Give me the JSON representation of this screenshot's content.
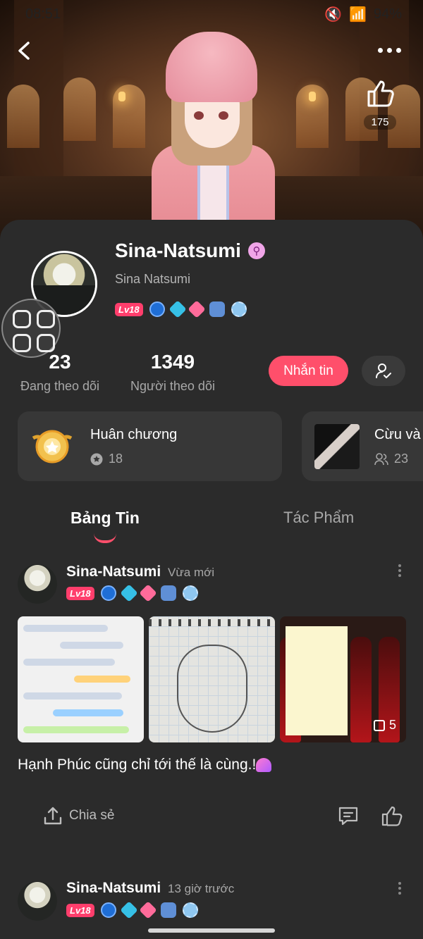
{
  "status_bar": {
    "time": "08:51",
    "battery": "94%"
  },
  "hero": {
    "like_count": "175"
  },
  "profile": {
    "name": "Sina-Natsumi",
    "gender_symbol": "⚲",
    "handle": "Sina Natsumi",
    "level": "Lv18",
    "following_count": "23",
    "following_label": "Đang theo dõi",
    "followers_count": "1349",
    "followers_label": "Người theo dõi",
    "message_button": "Nhắn tin"
  },
  "tiles": [
    {
      "title": "Huân chương",
      "count": "18"
    },
    {
      "title": "Cừu và",
      "count": "23"
    }
  ],
  "tabs": {
    "feed": "Bảng Tin",
    "works": "Tác Phẩm"
  },
  "posts": [
    {
      "author": "Sina-Natsumi",
      "time": "Vừa mới",
      "level": "Lv18",
      "image_count": "5",
      "text": "Hạnh Phúc cũng chỉ tới thế là cùng.!",
      "share_label": "Chia sẻ"
    },
    {
      "author": "Sina-Natsumi",
      "time": "13 giờ trước",
      "level": "Lv18"
    }
  ],
  "colors": {
    "accent": "#ff4f6b",
    "background": "#2b2b2b",
    "tile": "#373737"
  }
}
